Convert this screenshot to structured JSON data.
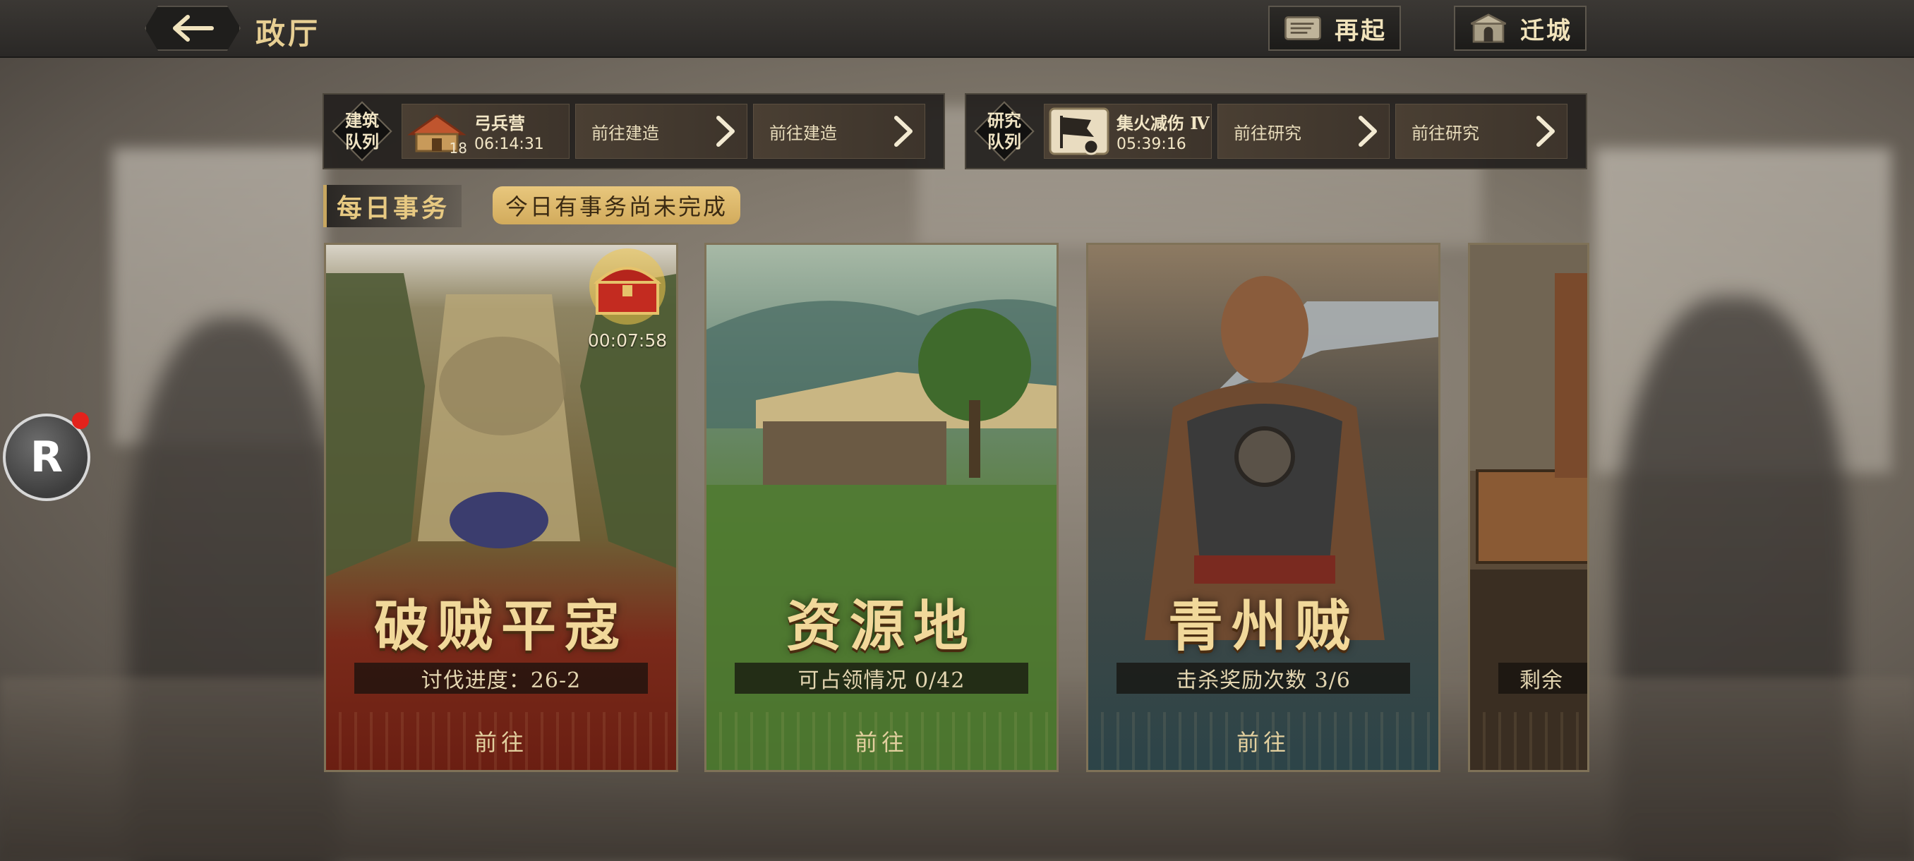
{
  "header": {
    "back_label": "",
    "title": "政厅",
    "buttons": [
      {
        "label": "再起",
        "icon": "scroll-icon"
      },
      {
        "label": "迁城",
        "icon": "city-gate-icon"
      }
    ]
  },
  "build_queue": {
    "badge": [
      "建筑",
      "队列"
    ],
    "current": {
      "name": "弓兵营",
      "level": "18",
      "time": "06:14:31",
      "icon": "archery-camp-icon"
    },
    "slots": [
      "前往建造",
      "前往建造"
    ]
  },
  "research_queue": {
    "badge": [
      "研究",
      "队列"
    ],
    "current": {
      "name": "集火减伤 Ⅳ",
      "time": "05:39:16",
      "icon": "banner-icon"
    },
    "slots": [
      "前往研究",
      "前往研究"
    ]
  },
  "daily": {
    "title": "每日事务",
    "notice": "今日有事务尚未完成"
  },
  "cards": [
    {
      "title": "破贼平寇",
      "progress": "讨伐进度：26-2",
      "action": "前往",
      "chest_timer": "00:07:58"
    },
    {
      "title": "资源地",
      "progress": "可占领情况 0/42",
      "action": "前往"
    },
    {
      "title": "青州贼",
      "progress": "击杀奖励次数 3/6",
      "action": "前往"
    },
    {
      "title": "",
      "progress": "剩余",
      "action": ""
    }
  ],
  "colors": {
    "gold_text": "#e7cf93",
    "notice_bg": "#d9b566",
    "card1_bg": "#7e2418",
    "card2_bg": "#3b5a2c",
    "card3_bg": "#2f4a4f",
    "notification_dot": "#e3221c"
  },
  "floating_button": {
    "label": "R"
  }
}
